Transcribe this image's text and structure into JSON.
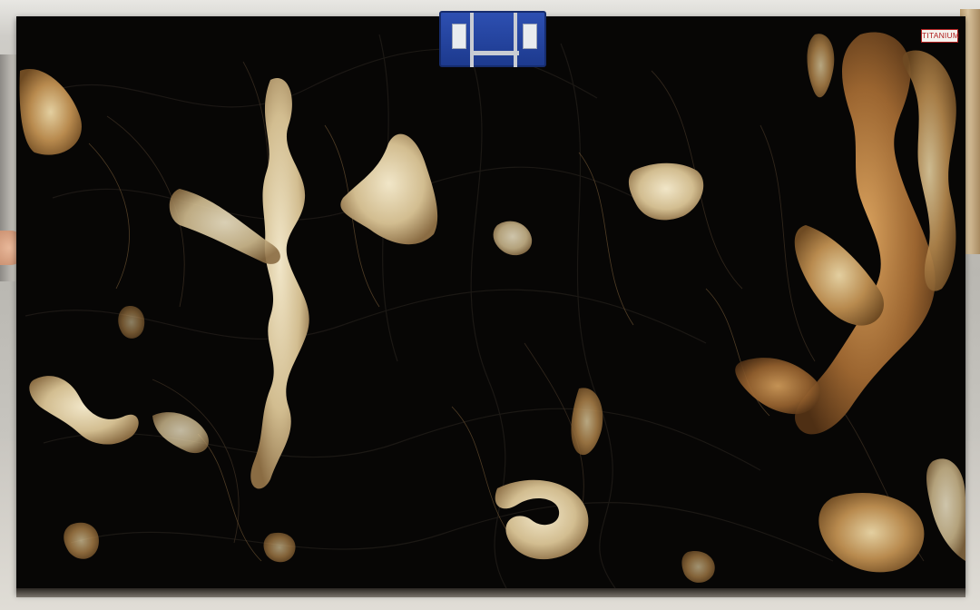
{
  "slab": {
    "name_tag": "TITANIUM"
  },
  "icons": {
    "clamp": "lifting-clamp-icon"
  },
  "colors": {
    "slab_base": "#070605",
    "vein_gold": "#b88a4e",
    "vein_cream": "#e0cfa6",
    "vein_rust": "#9b6530",
    "clamp_blue": "#2546a3",
    "tag_red": "#b02020"
  }
}
